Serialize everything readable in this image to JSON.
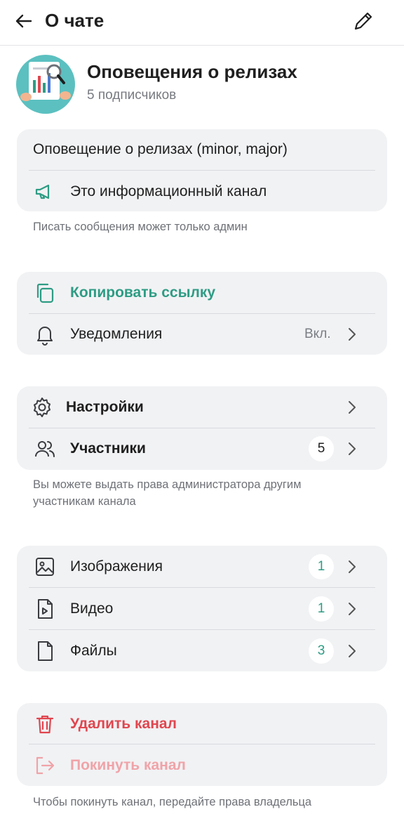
{
  "header": {
    "title": "О чате"
  },
  "channel": {
    "name": "Оповещения о релизах",
    "subscribers": "5 подписчиков"
  },
  "info": {
    "description": "Оповещение о релизах (minor, major)",
    "type_label": "Это информационный канал",
    "note": "Писать сообщения может только админ"
  },
  "actions": {
    "copy_link": "Копировать ссылку",
    "notifications": "Уведомления",
    "notifications_value": "Вкл."
  },
  "management": {
    "settings": "Настройки",
    "members": "Участники",
    "members_count": "5",
    "note_line1": "Вы можете выдать права администратора другим",
    "note_line2": "участникам канала"
  },
  "media": {
    "images": "Изображения",
    "images_count": "1",
    "video": "Видео",
    "video_count": "1",
    "files": "Файлы",
    "files_count": "3"
  },
  "danger": {
    "delete": "Удалить канал",
    "leave": "Покинуть канал",
    "note": "Чтобы покинуть канал, передайте права владельца"
  },
  "colors": {
    "accent": "#2e9c84",
    "danger": "#e0464f",
    "danger_disabled": "#f0a3a8",
    "card_bg": "#f1f2f4"
  }
}
